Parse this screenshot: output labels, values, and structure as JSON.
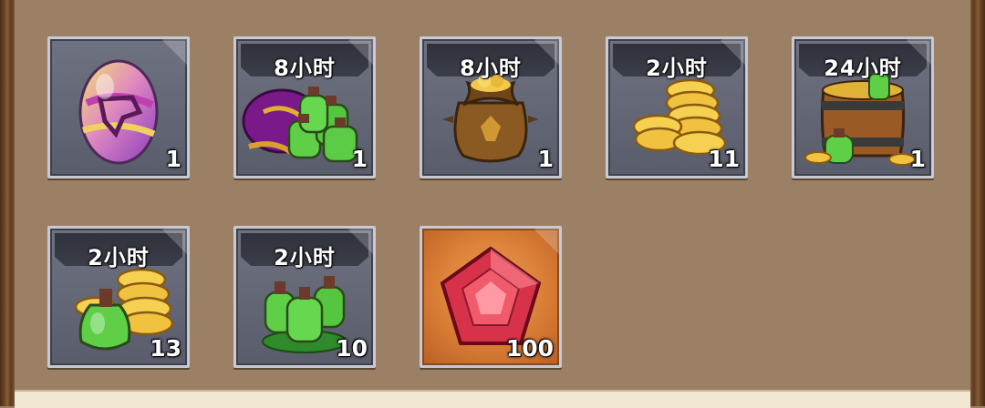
{
  "items": [
    {
      "name": "egg",
      "time": "",
      "count": "1"
    },
    {
      "name": "potion-bag",
      "time": "8小时",
      "count": "1"
    },
    {
      "name": "gold-sack",
      "time": "8小时",
      "count": "1"
    },
    {
      "name": "coin-stack",
      "time": "2小时",
      "count": "11"
    },
    {
      "name": "potion-barrel",
      "time": "24小时",
      "count": "1"
    },
    {
      "name": "coins-potion",
      "time": "2小时",
      "count": "13"
    },
    {
      "name": "potion-trio",
      "time": "2小时",
      "count": "10"
    },
    {
      "name": "red-gem",
      "time": "",
      "count": "100"
    }
  ]
}
